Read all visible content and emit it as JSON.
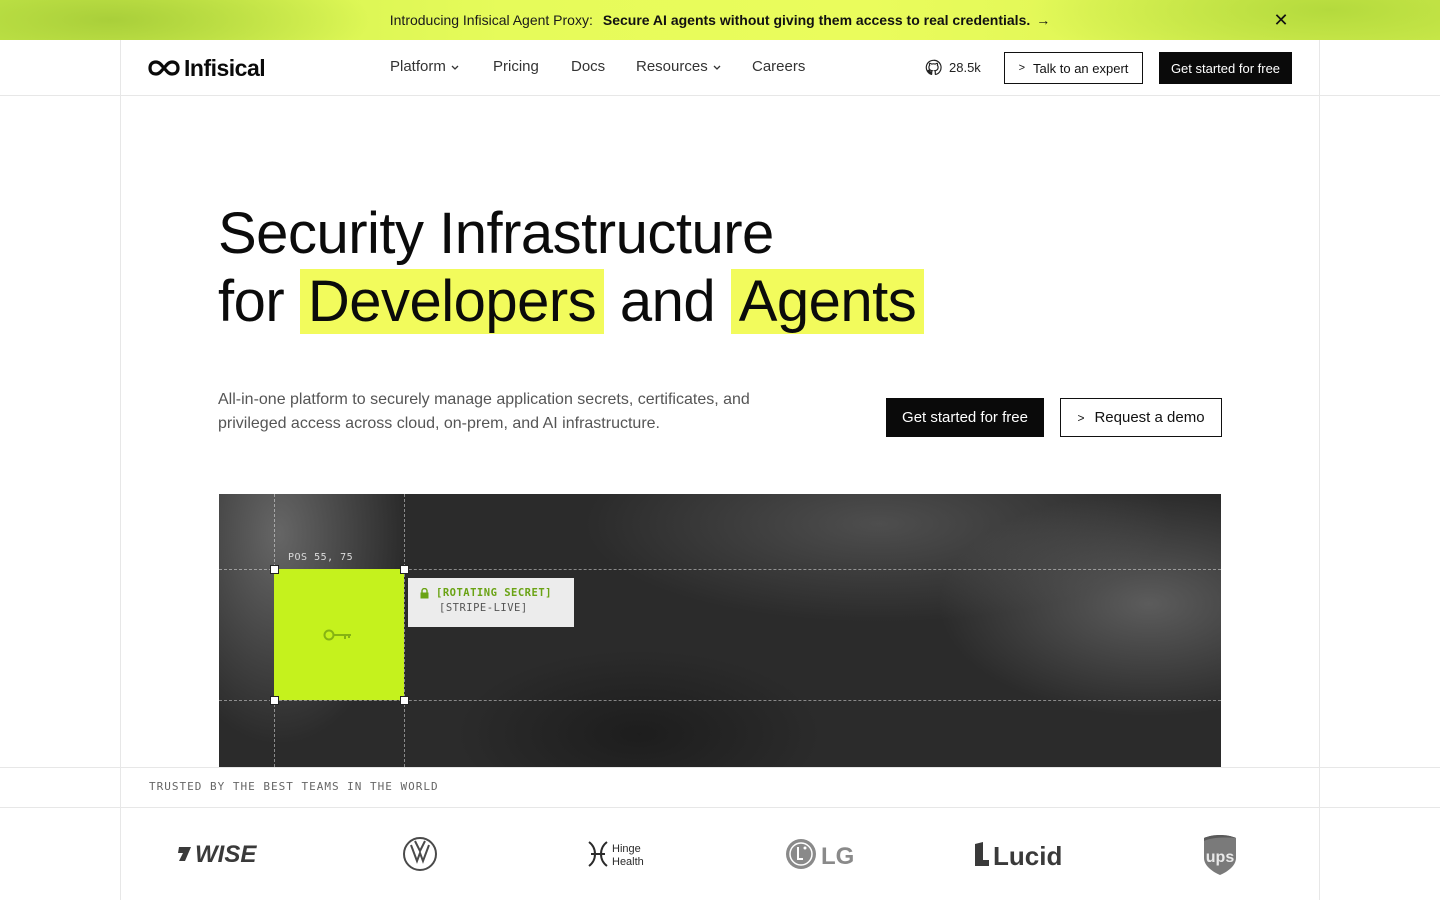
{
  "banner": {
    "intro": "Introducing Infisical Agent Proxy:",
    "headline": "Secure AI agents without giving them access to real credentials.",
    "arrow": "→",
    "close_icon": "close-icon"
  },
  "nav": {
    "logo_text": "Infisical",
    "links": [
      {
        "label": "Platform",
        "has_dropdown": true
      },
      {
        "label": "Pricing",
        "has_dropdown": false
      },
      {
        "label": "Docs",
        "has_dropdown": false
      },
      {
        "label": "Resources",
        "has_dropdown": true
      },
      {
        "label": "Careers",
        "has_dropdown": false
      }
    ],
    "github_stars": "28.5k",
    "talk_button": "Talk to an expert",
    "get_started_button": "Get started for free"
  },
  "hero": {
    "title_line1": "Security Infrastructure",
    "title_for": "for",
    "title_hl1": "Developers",
    "title_and": "and",
    "title_hl2": "Agents",
    "description": "All-in-one platform to securely manage application secrets, certificates, and privileged access across cloud, on-prem, and AI infrastructure.",
    "primary_button": "Get started for free",
    "secondary_button": "Request a demo"
  },
  "visual": {
    "pos_label": "POS 55, 75",
    "tooltip_title": "[ROTATING SECRET]",
    "tooltip_subtitle": "[STRIPE-LIVE]"
  },
  "trusted": {
    "label": "TRUSTED BY THE BEST TEAMS IN THE WORLD",
    "brands": [
      "WISE",
      "Volkswagen",
      "Hinge Health",
      "LG",
      "Lucid",
      "UPS"
    ],
    "brand_texts": {
      "wise": "WISE",
      "hinge_line1": "Hinge",
      "hinge_line2": "Health",
      "lg": "LG",
      "lucid": "Lucid",
      "ups": "ups"
    }
  },
  "colors": {
    "accent_highlight": "#f2fb5c",
    "key_box": "#c5f21d",
    "primary_button": "#0a0a0a"
  }
}
